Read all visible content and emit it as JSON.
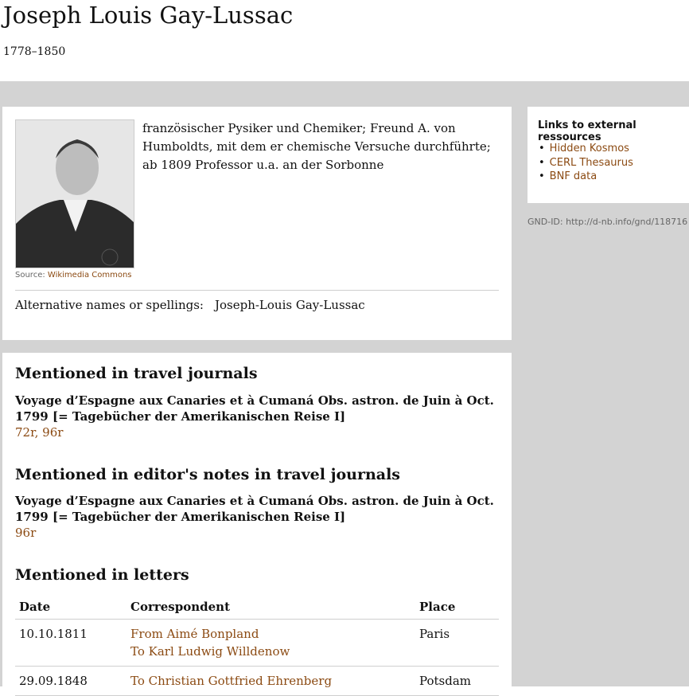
{
  "person": {
    "name": "Joseph Louis Gay-Lussac",
    "lifespan": "1778–1850",
    "description": "französischer Pysiker und Chemiker; Freund A. von Humboldts, mit dem er chemische Versuche durchführte; ab 1809 Professor u.a. an der Sorbonne",
    "image_source_label": "Source:",
    "image_source_link": "Wikimedia Commons",
    "alt_names_label": "Alternative names or spellings:",
    "alt_names_value": "Joseph-Louis Gay-Lussac"
  },
  "sections": {
    "travel": {
      "title": "Mentioned in travel journals",
      "journal": "Voyage d’Espagne aux Canaries et à Cumaná Obs. astron. de Juin à Oct. 1799 [= Tagebücher der Amerikanischen Reise I]",
      "pages": [
        "72r",
        "96r"
      ]
    },
    "editor": {
      "title": "Mentioned in editor's notes in travel journals",
      "journal": "Voyage d’Espagne aux Canaries et à Cumaná Obs. astron. de Juin à Oct. 1799 [= Tagebücher der Amerikanischen Reise I]",
      "pages": [
        "96r"
      ]
    },
    "letters": {
      "title": "Mentioned in letters",
      "headers": [
        "Date",
        "Correspondent",
        "Place"
      ],
      "rows": [
        {
          "date": "10.10.1811",
          "from": "From Aimé Bonpland",
          "to": "To Karl Ludwig Willdenow",
          "place": "Paris"
        },
        {
          "date": "29.09.1848",
          "to": "To Christian Gottfried Ehrenberg",
          "place": "Potsdam"
        }
      ]
    }
  },
  "sidebar": {
    "title": "Links to external ressources",
    "links": [
      "Hidden Kosmos",
      "CERL Thesaurus",
      "BNF data"
    ],
    "gnd": "GND-ID: http://d-nb.info/gnd/118716"
  },
  "colors": {
    "link": "#8b4a12",
    "background_grey": "#d3d3d3"
  }
}
